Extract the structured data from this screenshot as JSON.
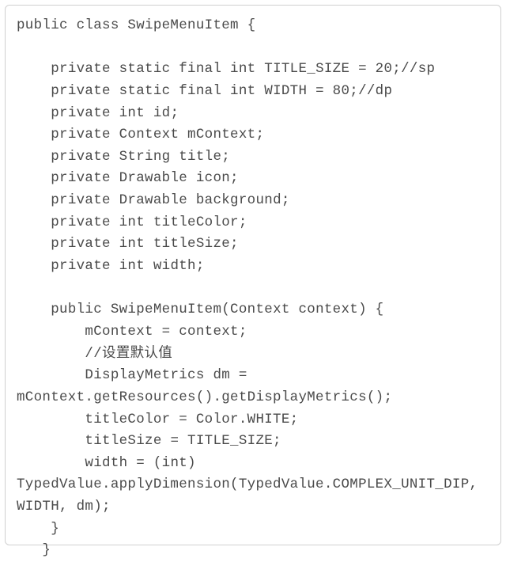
{
  "code": "public class SwipeMenuItem {\n\n    private static final int TITLE_SIZE = 20;//sp\n    private static final int WIDTH = 80;//dp\n    private int id;\n    private Context mContext;\n    private String title;\n    private Drawable icon;\n    private Drawable background;\n    private int titleColor;\n    private int titleSize;\n    private int width;\n\n    public SwipeMenuItem(Context context) {\n        mContext = context;\n        //设置默认值\n        DisplayMetrics dm = mContext.getResources().getDisplayMetrics();\n        titleColor = Color.WHITE;\n        titleSize = TITLE_SIZE;\n        width = (int) TypedValue.applyDimension(TypedValue.COMPLEX_UNIT_DIP, WIDTH, dm);\n    }\n   }"
}
